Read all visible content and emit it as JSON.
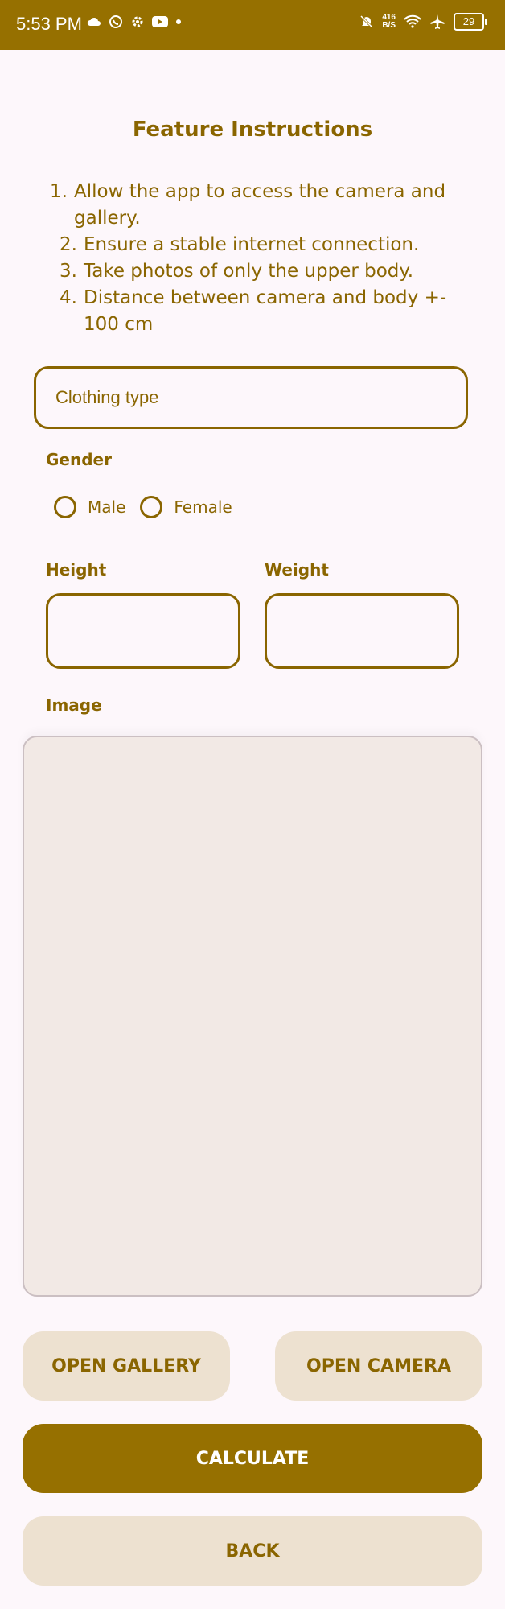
{
  "status_bar": {
    "time": "5:53 PM",
    "left_icons": [
      "cloud-icon",
      "whatsapp-icon",
      "settings-gear-icon",
      "youtube-icon",
      "dot-icon"
    ],
    "netspeed_value": "416",
    "netspeed_unit": "B/S",
    "battery": "29",
    "right_icons": [
      "mute-bell-icon",
      "wifi-icon",
      "airplane-icon",
      "battery-icon"
    ]
  },
  "page": {
    "title": "Feature Instructions",
    "instructions": [
      {
        "num": "1.",
        "text": "Allow the app to access the camera and gallery."
      },
      {
        "num": "2.",
        "text": "Ensure a stable internet connection."
      },
      {
        "num": "3.",
        "text": "Take photos of only the upper body."
      },
      {
        "num": "4.",
        "text": "Distance between camera and body +- 100 cm"
      }
    ]
  },
  "form": {
    "clothing_type_label": "Clothing type",
    "gender_label": "Gender",
    "gender_options": [
      "Male",
      "Female"
    ],
    "height_label": "Height",
    "weight_label": "Weight",
    "height_value": "",
    "weight_value": "",
    "image_label": "Image"
  },
  "buttons": {
    "open_gallery": "OPEN GALLERY",
    "open_camera": "OPEN CAMERA",
    "calculate": "CALCULATE",
    "back": "BACK"
  },
  "colors": {
    "primary": "#967000",
    "text": "#8a6500",
    "secondary_button": "#ede1d0",
    "background": "#fdf7fb",
    "image_placeholder": "#f2e9e5"
  }
}
